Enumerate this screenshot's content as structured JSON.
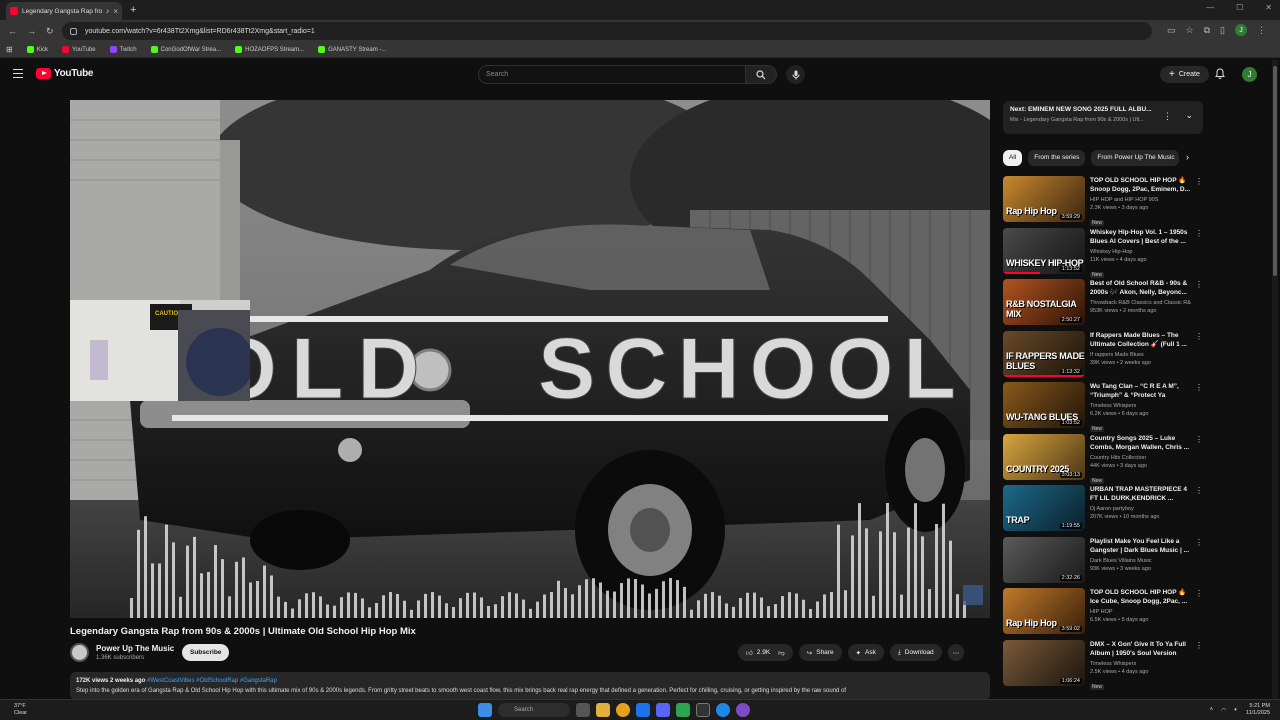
{
  "browser": {
    "tab_title": "Legendary Gangsta Rap fro...",
    "url": "youtube.com/watch?v=6r438Tt2Xmg&list=RD6r438Tt2Xmg&start_radio=1",
    "profile_initial": "J"
  },
  "bookmarks": [
    {
      "label": "Kick",
      "color": "#53fc18"
    },
    {
      "label": "YouTube",
      "color": "#ff0033"
    },
    {
      "label": "Twitch",
      "color": "#9146ff"
    },
    {
      "label": "ConGodOfWar Strea...",
      "color": "#53fc18"
    },
    {
      "label": "HOZAOFPS Stream...",
      "color": "#53fc18"
    },
    {
      "label": "GANASTY Stream -...",
      "color": "#53fc18"
    }
  ],
  "youtube": {
    "logo_text": "YouTube",
    "search_placeholder": "Search",
    "create_label": "Create",
    "avatar_initial": "J"
  },
  "video": {
    "overlay_text_left": "OLD",
    "overlay_text_right": "SCHOOL",
    "title": "Legendary Gangsta Rap from 90s & 2000s | Ultimate Old School Hip Hop Mix",
    "channel": "Power Up The Music",
    "subscribers": "1.36K subscribers",
    "subscribe_label": "Subscribe",
    "likes": "2.9K",
    "share_label": "Share",
    "ask_label": "Ask",
    "download_label": "Download",
    "description_meta": "172K views  2 weeks ago",
    "description_tags": "#WestCoastVibes #OldSchoolRap #GangstaRap",
    "description_text": "Step into the golden era of Gangsta Rap & Old School Hip Hop with this ultimate mix of 90s & 2000s legends. From gritty street beats to smooth west coast flow, this mix brings back real rap energy that defined a generation. Perfect for chilling, cruising, or getting inspired by the raw sound of"
  },
  "playlist": {
    "next_title": "Next: EMINEM NEW SONG 2025 FULL ALBU...",
    "next_sub": "Mix - Legendary Gangsta Rap from 90s & 2000s | Ult..."
  },
  "chips": [
    {
      "label": "All",
      "active": true
    },
    {
      "label": "From the series",
      "active": false
    },
    {
      "label": "From Power Up The Music",
      "active": false
    }
  ],
  "recommendations": [
    {
      "title": "TOP OLD SCHOOL HIP HOP 🔥 Snoop Dogg, 2Pac, Eminem, D...",
      "channel": "HIP HOP and HIP HOP 90S",
      "views": "2.3K views • 3 days ago",
      "badge": "New",
      "duration": "3:59:29",
      "thumb_text": "Rap Hip Hop",
      "c1": "#c98a2e",
      "c2": "#3a2310",
      "progress": 0
    },
    {
      "title": "Whiskey Hip-Hop Vol. 1 – 1950s Blues AI Covers | Best of the ...",
      "channel": "Whiskey Hip-Hop",
      "views": "11K views • 4 days ago",
      "badge": "New",
      "duration": "1:13:52",
      "thumb_text": "WHISKEY HIP-HOP",
      "c1": "#4a4a4a",
      "c2": "#141414",
      "progress": 0.45
    },
    {
      "title": "Best of Old School R&B - 90s & 2000s 🎶 Akon, Nelly, Beyonc...",
      "channel": "Throwback R&B Classics and Classic R&...",
      "views": "953K views • 2 months ago",
      "badge": "",
      "duration": "2:50:27",
      "thumb_text": "R&B NOSTALGIA MIX",
      "c1": "#b3541e",
      "c2": "#2b1308",
      "progress": 0
    },
    {
      "title": "If Rappers Made Blues – The Ultimate Collection 🎸 (Full 1 ...",
      "channel": "If rappers Made Blues",
      "views": "39K views • 2 weeks ago",
      "badge": "",
      "duration": "1:13:32",
      "thumb_text": "IF RAPPERS MADE BLUES",
      "c1": "#6a4a2a",
      "c2": "#1a120a",
      "progress": 1
    },
    {
      "title": "Wu Tang Clan – “C R E A M”, “Triumph” & “Protect Ya Neck”...",
      "channel": "Timeless Whispers",
      "views": "6.2K views • 6 days ago",
      "badge": "New",
      "duration": "1:03:52",
      "thumb_text": "WU-TANG BLUES",
      "c1": "#8a5a1a",
      "c2": "#20140a",
      "progress": 0
    },
    {
      "title": "Country Songs 2025 – Luke Combs, Morgan Wallen, Chris ...",
      "channel": "Country Hits Collection",
      "views": "44K views • 3 days ago",
      "badge": "New",
      "duration": "3:03:13",
      "thumb_text": "COUNTRY 2025",
      "c1": "#d9a640",
      "c2": "#4a3515",
      "progress": 0
    },
    {
      "title": "URBAN TRAP MASTERPIECE 4 FT LIL DURK,KENDRICK ...",
      "channel": "Dj Aaron partyboy",
      "views": "207K views • 10 months ago",
      "badge": "",
      "duration": "1:19:55",
      "thumb_text": "TRAP",
      "c1": "#1c6a8a",
      "c2": "#0a1e2a",
      "progress": 0
    },
    {
      "title": "Playlist Make You Feel Like a Gangster | Dark Blues Music | ...",
      "channel": "Dark Blues Villains Music",
      "views": "93K views • 3 weeks ago",
      "badge": "",
      "duration": "2:32:26",
      "thumb_text": "",
      "c1": "#5a5a5a",
      "c2": "#1a1a1a",
      "progress": 0
    },
    {
      "title": "TOP OLD SCHOOL HIP HOP 🔥 Ice Cube, Snoop Dogg, 2Pac, ...",
      "channel": "HIP HOP",
      "views": "6.5K views • 5 days ago",
      "badge": "",
      "duration": "3:59:02",
      "thumb_text": "Rap Hip Hop",
      "c1": "#c07a2a",
      "c2": "#3a1f0a",
      "progress": 0
    },
    {
      "title": "DMX – X Gon' Give It To Ya Full Album | 1950's Soul Version",
      "channel": "Timeless Whispers",
      "views": "2.5K views • 4 days ago",
      "badge": "New",
      "duration": "1:06:24",
      "thumb_text": "",
      "c1": "#7a5a3a",
      "c2": "#1c140c",
      "progress": 0
    }
  ],
  "taskbar": {
    "weather_temp": "37°F",
    "weather_desc": "Clear",
    "search_label": "Search",
    "time": "5:21 PM",
    "date": "11/1/2025"
  }
}
